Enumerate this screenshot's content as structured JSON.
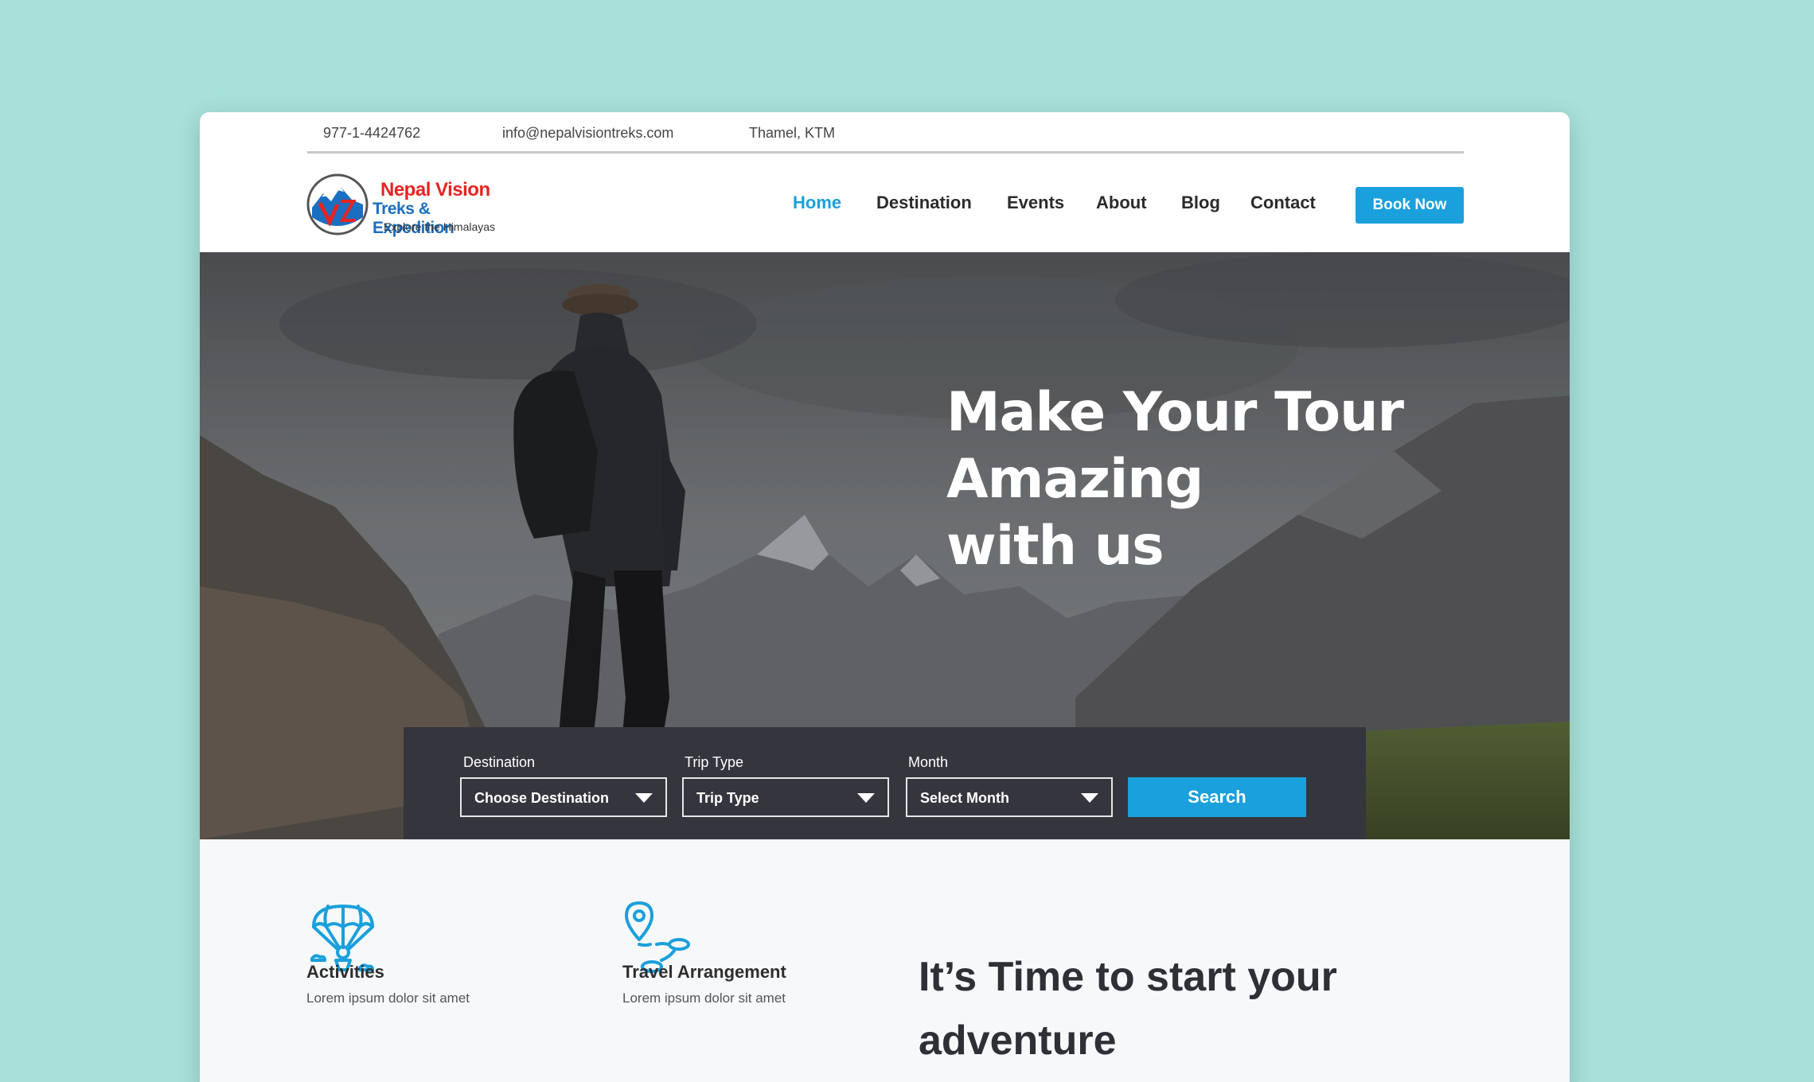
{
  "topbar": {
    "phone": "977-1-4424762",
    "email": "info@nepalvisiontreks.com",
    "location": "Thamel, KTM"
  },
  "logo": {
    "line1": "Nepal Vision",
    "line2": "Treks & Expedition",
    "line3": "Explore the Himalayas"
  },
  "nav": {
    "items": [
      {
        "label": "Home",
        "active": true
      },
      {
        "label": "Destination"
      },
      {
        "label": "Events"
      },
      {
        "label": "About"
      },
      {
        "label": "Blog"
      },
      {
        "label": "Contact"
      }
    ],
    "book_label": "Book Now"
  },
  "hero": {
    "title_lines": [
      "Make Your Tour",
      "Amazing",
      "with us"
    ]
  },
  "search": {
    "fields": [
      {
        "label": "Destination",
        "value": "Choose Destination"
      },
      {
        "label": "Trip Type",
        "value": "Trip Type"
      },
      {
        "label": "Month",
        "value": "Select Month"
      }
    ],
    "button_label": "Search"
  },
  "features": [
    {
      "title": "Activities",
      "desc": "Lorem ipsum dolor sit amet",
      "icon": "parachute-icon"
    },
    {
      "title": "Travel Arrangement",
      "desc": "Lorem ipsum dolor sit amet",
      "icon": "map-route-icon"
    }
  ],
  "headline": {
    "line1": "It’s Time to start your",
    "line2": "adventure"
  },
  "colors": {
    "background": "#a7e1da",
    "accent": "#1aa0dc",
    "search_panel": "#35353d",
    "logo_red": "#e52421",
    "logo_blue": "#1b6fc2"
  }
}
